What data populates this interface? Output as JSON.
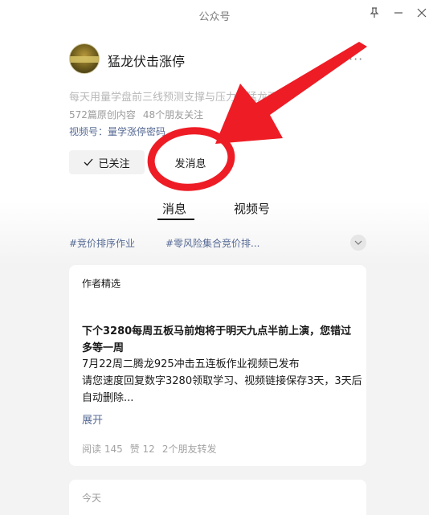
{
  "window": {
    "title": "公众号"
  },
  "account": {
    "name": "猛龙伏击涨停",
    "description": "每天用量学盘前三线预测支撑与压力是猛龙强",
    "stats": {
      "articles": "572篇原创内容",
      "friends": "48个朋友关注"
    },
    "channel": "视频号：量学涨停密码"
  },
  "actions": {
    "follow": "已关注",
    "message": "发消息"
  },
  "tabs": [
    {
      "label": "消息"
    },
    {
      "label": "视频号"
    }
  ],
  "tags": [
    "#竞价排序作业",
    "#零风险集合竞价排..."
  ],
  "article": {
    "label": "作者精选",
    "title": "下个3280每周五板马前炮将于明天九点半前上演，您错过多等一周",
    "body": "7月22周二腾龙925冲击五连板作业视频已发布\n请您速度回复数字3280领取学习、视频链接保存3天，3天后自动删除...",
    "expand": "展开",
    "meta": {
      "reads": "阅读 145",
      "likes": "赞 12",
      "shares": "2个朋友转发"
    }
  },
  "next_section": {
    "label": "今天"
  },
  "annotation": {
    "color": "#ee1c25"
  }
}
